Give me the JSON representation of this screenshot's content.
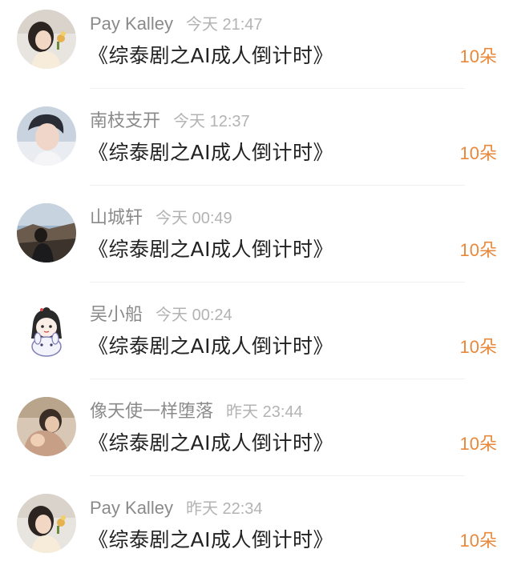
{
  "comments": [
    {
      "username": "Pay Kalley",
      "time": "今天 21:47",
      "title": "《综泰剧之AI成人倒计时》",
      "gift": "10朵",
      "avatar": "avatar-woman-flower"
    },
    {
      "username": "南枝支开",
      "time": "今天 12:37",
      "title": "《综泰剧之AI成人倒计时》",
      "gift": "10朵",
      "avatar": "avatar-young-man"
    },
    {
      "username": "山城轩",
      "time": "今天 00:49",
      "title": "《综泰剧之AI成人倒计时》",
      "gift": "10朵",
      "avatar": "avatar-landscape-person"
    },
    {
      "username": "吴小船",
      "time": "今天 00:24",
      "title": "《综泰剧之AI成人倒计时》",
      "gift": "10朵",
      "avatar": "avatar-cartoon-girl"
    },
    {
      "username": "像天使一样堕落",
      "time": "昨天 23:44",
      "title": "《综泰剧之AI成人倒计时》",
      "gift": "10朵",
      "avatar": "avatar-mother-child"
    },
    {
      "username": "Pay Kalley",
      "time": "昨天 22:34",
      "title": "《综泰剧之AI成人倒计时》",
      "gift": "10朵",
      "avatar": "avatar-woman-flower"
    }
  ],
  "colors": {
    "username": "#8a8a8a",
    "time": "#b3b3b3",
    "title": "#222222",
    "gift": "#e9883a",
    "divider": "#f0f0f0"
  }
}
